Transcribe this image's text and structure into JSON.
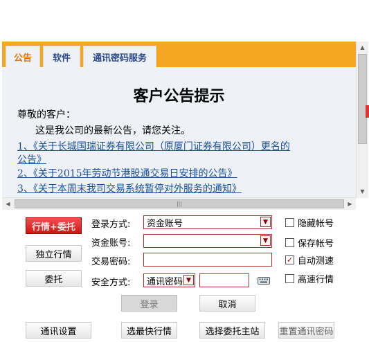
{
  "tabs": [
    {
      "label": "公告"
    },
    {
      "label": "软件"
    },
    {
      "label": "通讯密码服务"
    }
  ],
  "notice": {
    "title": "客户公告提示",
    "greeting": "尊敬的客户：",
    "intro": "这是我公司的最新公告，请您关注。",
    "links": [
      "1、《关于长城国瑞证券有限公司（原厦门证券有限公司）更名的",
      "公告》",
      "2、《关于2015年劳动节港股通交易日安排的公告》",
      "3、《关于本周末我司交易系统暂停对外服务的通知》"
    ]
  },
  "side_buttons": {
    "market_trade": "行情+委托",
    "market_only": "独立行情",
    "trade": "委托"
  },
  "login_form": {
    "login_mode_label": "登录方式:",
    "login_mode_value": "资金账号",
    "account_label": "资金账号:",
    "account_value": "",
    "password_label": "交易密码:",
    "password_value": "",
    "security_label": "安全方式:",
    "security_value": "通讯密码",
    "security_code_value": ""
  },
  "options": {
    "hide_account": {
      "label": "隐藏帐号",
      "checked": false
    },
    "save_account": {
      "label": "保存帐号",
      "checked": false
    },
    "auto_speed_test": {
      "label": "自动测速",
      "checked": true
    },
    "fast_market": {
      "label": "高速行情",
      "checked": false
    }
  },
  "actions": {
    "login": "登录",
    "cancel": "取消"
  },
  "bottom_buttons": {
    "comm_settings": "通讯设置",
    "fastest_market": "选最快行情",
    "choose_trade_site": "选择委托主站",
    "reset_comm_password": "重置通讯密码"
  },
  "colors": {
    "tab_bar": "#f5a623",
    "active_tab_text": "#e07800",
    "link": "#1a4fa0",
    "field_border": "#b03030",
    "primary_button": "#cc1515"
  }
}
